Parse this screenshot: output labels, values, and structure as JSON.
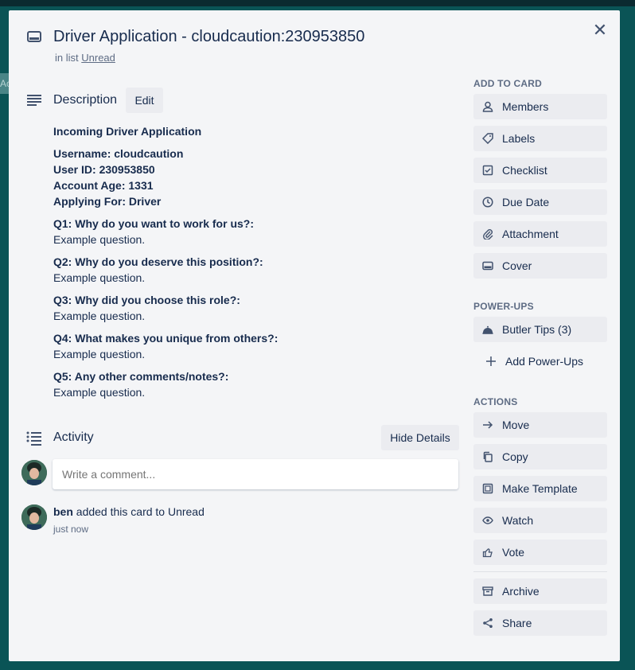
{
  "background": {
    "ghost_text": "Ac"
  },
  "card": {
    "title": "Driver Application - cloudcaution:230953850",
    "in_list_prefix": "in list",
    "list_name": "Unread"
  },
  "description": {
    "heading": "Description",
    "edit_label": "Edit",
    "lines": {
      "intro": "Incoming Driver Application",
      "username": "Username: cloudcaution",
      "user_id": "User ID: 230953850",
      "account_age": "Account Age: 1331",
      "applying_for": "Applying For: Driver",
      "q1": "Q1: Why do you want to work for us?:",
      "a1": "Example question.",
      "q2": "Q2: Why do you deserve this position?:",
      "a2": "Example question.",
      "q3": "Q3: Why did you choose this role?:",
      "a3": "Example question.",
      "q4": "Q4: What makes you unique from others?:",
      "a4": "Example question.",
      "q5": "Q5: Any other comments/notes?:",
      "a5": "Example question."
    }
  },
  "activity": {
    "heading": "Activity",
    "hide_details_label": "Hide Details",
    "comment_placeholder": "Write a comment...",
    "entry_user": "ben",
    "entry_text": "added this card to Unread",
    "entry_time": "just now"
  },
  "sidebar": {
    "add_to_card_heading": "Add to card",
    "add_to_card": [
      {
        "label": "Members",
        "icon": "person-icon"
      },
      {
        "label": "Labels",
        "icon": "tag-icon"
      },
      {
        "label": "Checklist",
        "icon": "checkbox-icon"
      },
      {
        "label": "Due Date",
        "icon": "clock-icon"
      },
      {
        "label": "Attachment",
        "icon": "paperclip-icon"
      },
      {
        "label": "Cover",
        "icon": "cover-icon"
      }
    ],
    "power_ups_heading": "Power-Ups",
    "power_ups": [
      {
        "label": "Butler Tips (3)",
        "icon": "bell-icon"
      },
      {
        "label": "Add Power-Ups",
        "icon": "plus-icon"
      }
    ],
    "actions_heading": "Actions",
    "actions": [
      {
        "label": "Move",
        "icon": "arrow-right-icon"
      },
      {
        "label": "Copy",
        "icon": "copy-icon"
      },
      {
        "label": "Make Template",
        "icon": "template-icon"
      },
      {
        "label": "Watch",
        "icon": "eye-icon"
      },
      {
        "label": "Vote",
        "icon": "thumbs-up-icon"
      },
      {
        "label": "Archive",
        "icon": "archive-icon"
      },
      {
        "label": "Share",
        "icon": "share-icon"
      }
    ]
  },
  "colors": {
    "board_background": "#0c5d5e",
    "modal_background": "#f4f5f7",
    "button_background": "#ebecf0",
    "text_primary": "#172b4d",
    "text_secondary": "#5e6c84"
  }
}
